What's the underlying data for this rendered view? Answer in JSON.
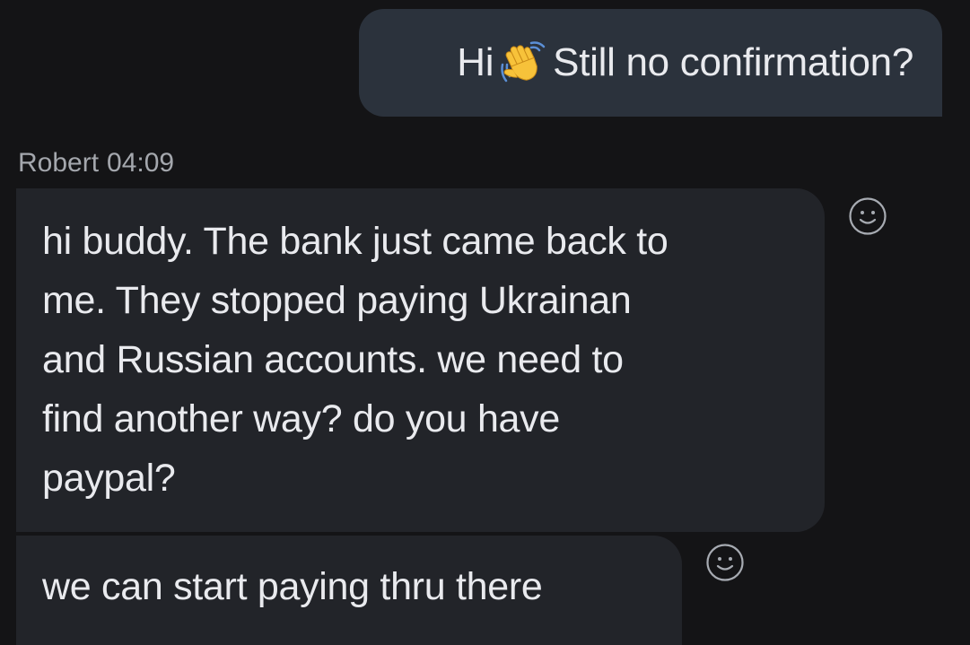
{
  "messages": {
    "outgoing": {
      "text_before": "Hi",
      "emoji": "waving-hand",
      "text_after": "Still no confirmation?"
    },
    "sender": {
      "name": "Robert",
      "time": "04:09"
    },
    "incoming": [
      {
        "lines": [
          "hi buddy. The bank just came back to",
          "me. They stopped paying Ukrainan",
          "and Russian accounts. we need to",
          "find another way? do you have",
          "paypal?"
        ]
      },
      {
        "text": "we can start paying thru there"
      }
    ]
  },
  "icons": {
    "reaction": "smiley-face-icon",
    "reaction_color": "#a7abb2"
  },
  "colors": {
    "background": "#141416",
    "outgoing_bubble": "#2b323c",
    "incoming_bubble": "#222429",
    "text": "#e9eaee",
    "meta_text": "#a4a7ad"
  }
}
